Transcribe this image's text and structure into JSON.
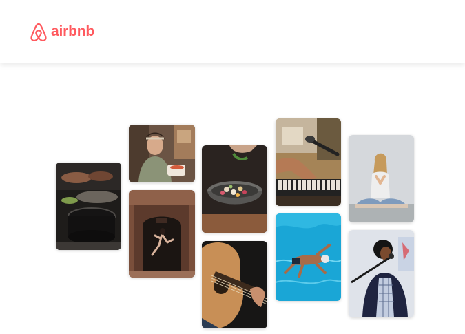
{
  "header": {
    "logo": {
      "wordmark": "airbnb",
      "icon": "airbnb-belo-icon"
    }
  },
  "colors": {
    "brand": "#ff5a5f",
    "background": "#ffffff"
  },
  "collage": {
    "photos": [
      {
        "name": "photo-cooking-hands"
      },
      {
        "name": "photo-woman-cooking"
      },
      {
        "name": "photo-dancer-doorway"
      },
      {
        "name": "photo-food-bowl"
      },
      {
        "name": "photo-guitar"
      },
      {
        "name": "photo-piano-microphone"
      },
      {
        "name": "photo-swimmer"
      },
      {
        "name": "photo-yoga"
      },
      {
        "name": "photo-singer"
      }
    ]
  }
}
